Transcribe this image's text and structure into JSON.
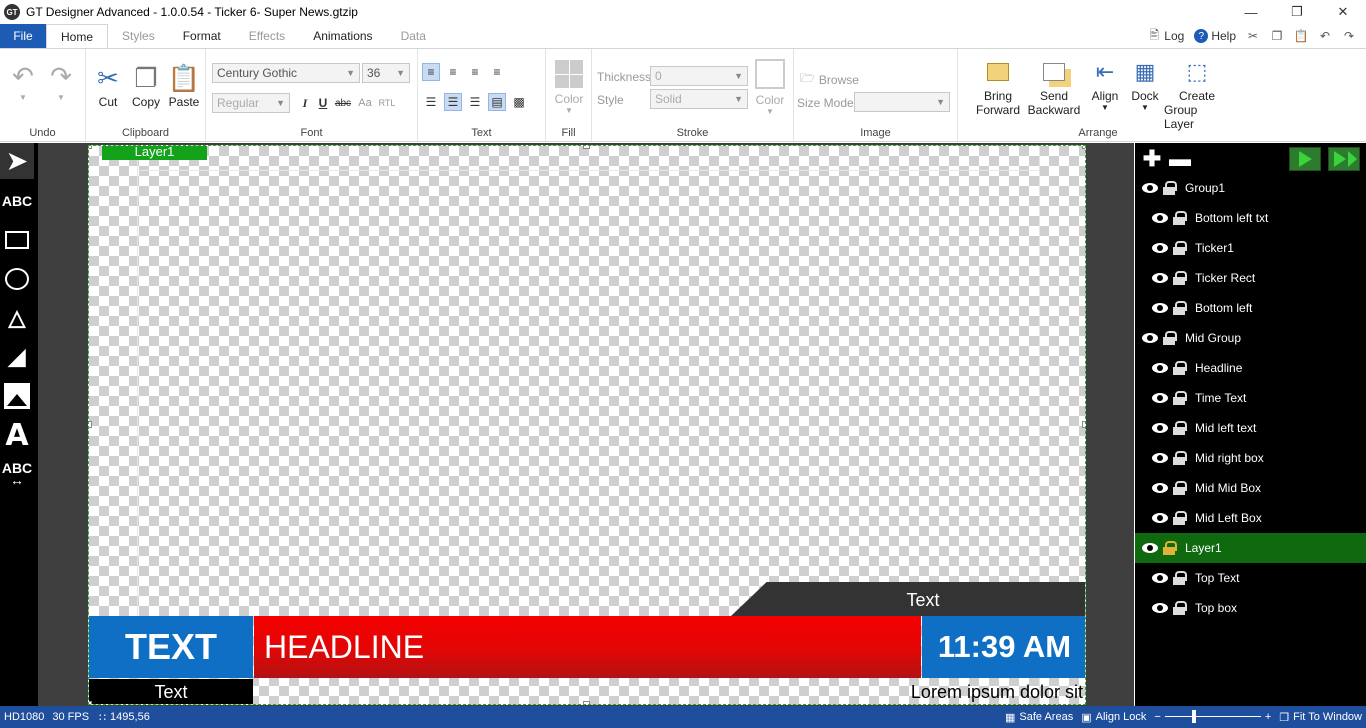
{
  "window": {
    "title": "GT Designer Advanced - 1.0.0.54 - Ticker 6- Super News.gtzip",
    "app_icon": "GT"
  },
  "tabs": [
    "File",
    "Home",
    "Styles",
    "Format",
    "Effects",
    "Animations",
    "Data"
  ],
  "topright": {
    "log": "Log",
    "help": "Help"
  },
  "ribbon": {
    "undo_label": "Undo",
    "clipboard": {
      "cut": "Cut",
      "copy": "Copy",
      "paste": "Paste",
      "label": "Clipboard"
    },
    "font": {
      "family": "Century Gothic",
      "size": "36",
      "style": "Regular",
      "label": "Font"
    },
    "text_label": "Text",
    "fill": {
      "color": "Color",
      "label": "Fill"
    },
    "stroke": {
      "thickness_label": "Thickness",
      "thickness_value": "0",
      "style_label": "Style",
      "style_value": "Solid",
      "color": "Color",
      "label": "Stroke"
    },
    "image": {
      "browse": "Browse",
      "size_mode": "Size Mode",
      "label": "Image"
    },
    "arrange": {
      "bring_1": "Bring",
      "bring_2": "Forward",
      "send_1": "Send",
      "send_2": "Backward",
      "align": "Align",
      "dock": "Dock",
      "create_1": "Create",
      "create_2": "Group Layer",
      "label": "Arrange"
    }
  },
  "tools": {
    "text_tool": "ABC",
    "stretch_text_tool": "ABC"
  },
  "canvas": {
    "layer_tag": "Layer1",
    "top_text": "Text",
    "left_box_text": "TEXT",
    "headline": "HEADLINE",
    "time": "11:39 AM",
    "bottom_left_text": "Text",
    "ticker": "Lorem ipsum dolor sit"
  },
  "layers": [
    {
      "name": "Group1",
      "level": 0,
      "selected": false
    },
    {
      "name": "Bottom left txt",
      "level": 1,
      "selected": false
    },
    {
      "name": "Ticker1",
      "level": 1,
      "selected": false
    },
    {
      "name": "Ticker Rect",
      "level": 1,
      "selected": false
    },
    {
      "name": "Bottom left",
      "level": 1,
      "selected": false
    },
    {
      "name": "Mid Group",
      "level": 0,
      "selected": false
    },
    {
      "name": "Headline",
      "level": 1,
      "selected": false
    },
    {
      "name": "Time Text",
      "level": 1,
      "selected": false
    },
    {
      "name": "Mid left text",
      "level": 1,
      "selected": false
    },
    {
      "name": "Mid right box",
      "level": 1,
      "selected": false
    },
    {
      "name": "Mid Mid Box",
      "level": 1,
      "selected": false
    },
    {
      "name": "Mid Left Box",
      "level": 1,
      "selected": false
    },
    {
      "name": "Layer1",
      "level": 0,
      "selected": true
    },
    {
      "name": "Top Text",
      "level": 1,
      "selected": false
    },
    {
      "name": "Top box",
      "level": 1,
      "selected": false
    }
  ],
  "status": {
    "format": "HD1080",
    "fps": "30 FPS",
    "coords": "1495,56",
    "safe_areas": "Safe Areas",
    "align_lock": "Align Lock",
    "fit": "Fit To Window",
    "zoom_minus": "−",
    "zoom_plus": "+"
  },
  "colors": {
    "accent": "#1e5bb5",
    "selected_layer": "#0f6a0f",
    "headline_red": "#e20606",
    "box_blue": "#0e6fc4",
    "layer_tag": "#12a31a"
  }
}
